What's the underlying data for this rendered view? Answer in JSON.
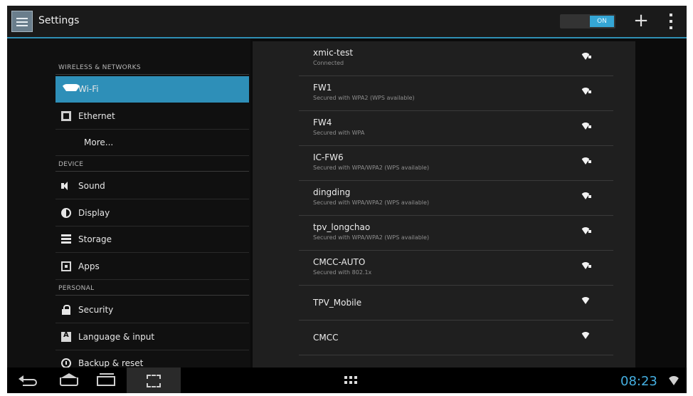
{
  "actionbar": {
    "title": "Settings",
    "toggle_label": "ON",
    "add_icon": "plus-icon",
    "overflow_icon": "overflow-menu-icon"
  },
  "sidebar": {
    "categories": [
      "WIRELESS & NETWORKS",
      "DEVICE",
      "PERSONAL"
    ],
    "items": [
      {
        "label": "Wi-Fi",
        "icon": "wifi-icon",
        "selected": true
      },
      {
        "label": "Ethernet",
        "icon": "ethernet-icon"
      },
      {
        "label": "More...",
        "icon": ""
      },
      {
        "label": "Sound",
        "icon": "sound-icon"
      },
      {
        "label": "Display",
        "icon": "display-icon"
      },
      {
        "label": "Storage",
        "icon": "storage-icon"
      },
      {
        "label": "Apps",
        "icon": "apps-icon"
      },
      {
        "label": "Security",
        "icon": "lock-icon"
      },
      {
        "label": "Language & input",
        "icon": "language-icon"
      },
      {
        "label": "Backup & reset",
        "icon": "backup-icon"
      }
    ]
  },
  "networks": [
    {
      "name": "xmic-test",
      "status": "Connected"
    },
    {
      "name": "FW1",
      "status": "Secured with WPA2 (WPS available)"
    },
    {
      "name": "FW4",
      "status": "Secured with WPA"
    },
    {
      "name": "IC-FW6",
      "status": "Secured with WPA/WPA2 (WPS available)"
    },
    {
      "name": "dingding",
      "status": "Secured with WPA/WPA2 (WPS available)"
    },
    {
      "name": "tpv_longchao",
      "status": "Secured with WPA/WPA2 (WPS available)"
    },
    {
      "name": "CMCC-AUTO",
      "status": "Secured with 802.1x"
    },
    {
      "name": "TPV_Mobile",
      "status": ""
    },
    {
      "name": "CMCC",
      "status": ""
    }
  ],
  "navbar": {
    "clock": "08:23"
  },
  "colors": {
    "accent": "#2e8fb8",
    "clock": "#44aee0"
  }
}
